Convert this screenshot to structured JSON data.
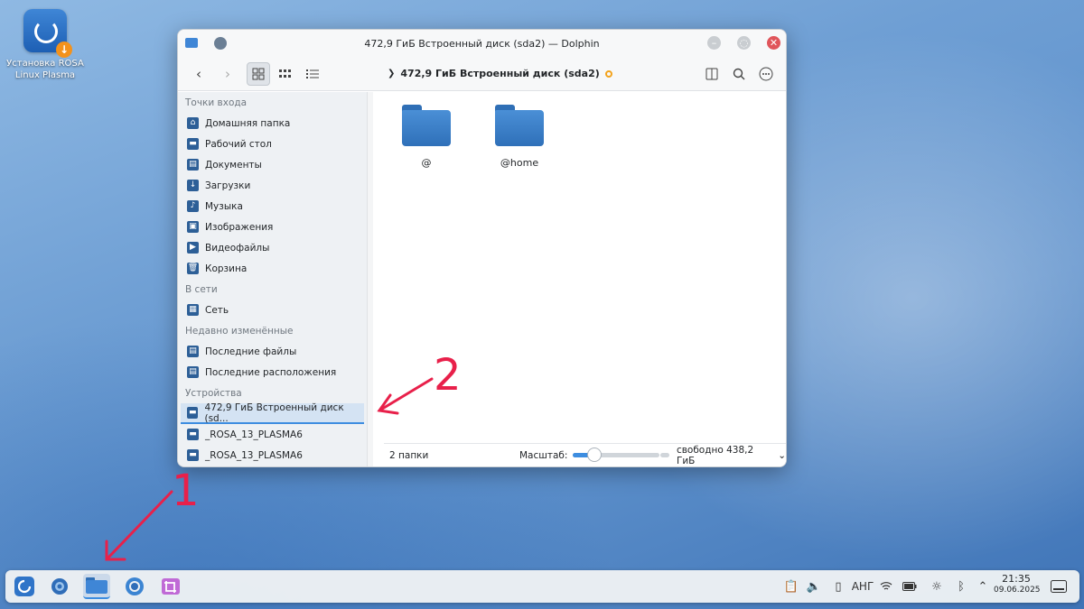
{
  "desktop": {
    "icon_label": "Установка ROSA Linux Plasma"
  },
  "window": {
    "title": "472,9 ГиБ Встроенный диск (sda2) — Dolphin",
    "breadcrumb": "472,9 ГиБ Встроенный диск (sda2)"
  },
  "sidebar": {
    "groups": [
      {
        "label": "Точки входа",
        "items": [
          "Домашняя папка",
          "Рабочий стол",
          "Документы",
          "Загрузки",
          "Музыка",
          "Изображения",
          "Видеофайлы",
          "Корзина"
        ]
      },
      {
        "label": "В сети",
        "items": [
          "Сеть"
        ]
      },
      {
        "label": "Недавно изменённые",
        "items": [
          "Последние файлы",
          "Последние расположения"
        ]
      },
      {
        "label": "Устройства",
        "items": [
          "472,9 ГиБ Встроенный диск (sd...",
          "_ROSA_13_PLASMA6",
          "_ROSA_13_PLASMA6"
        ]
      }
    ]
  },
  "content": {
    "folders": [
      "@",
      "@home"
    ]
  },
  "statusbar": {
    "count": "2 папки",
    "zoom_label": "Масштаб:",
    "zoom_level": 0.25,
    "free": "свободно 438,2 ГиБ"
  },
  "annotations": {
    "one": "1",
    "two": "2",
    "color": "#e8204a"
  },
  "taskbar": {
    "keyboard_layout": "АНГ",
    "time": "21:35",
    "date": "09.06.2025"
  },
  "icons": {
    "sidebar": [
      "home-icon",
      "desktop-icon",
      "documents-icon",
      "downloads-icon",
      "music-icon",
      "pictures-icon",
      "videos-icon",
      "trash-icon",
      "network-icon",
      "recent-files-icon",
      "recent-locations-icon",
      "drive-icon",
      "drive-icon",
      "drive-icon"
    ]
  }
}
